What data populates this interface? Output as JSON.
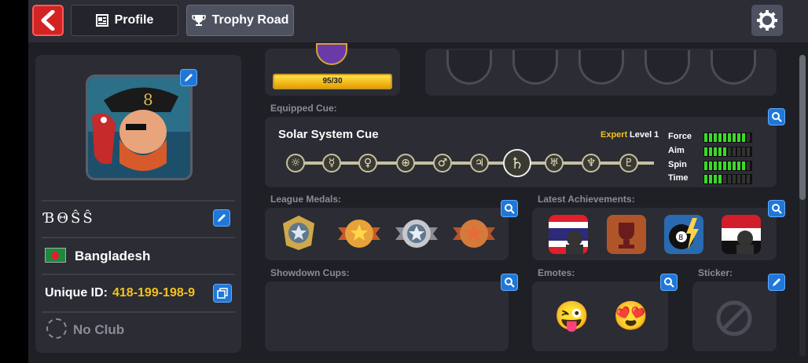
{
  "nav": {
    "profile_tab": "Profile",
    "trophy_tab": "Trophy Road"
  },
  "player": {
    "name": "ƁΘŜŜ",
    "country": "Bangladesh",
    "unique_id_label": "Unique ID:",
    "unique_id": "418-199-198-9",
    "club": "No Club",
    "level_progress": "95/30",
    "level_progress_fraction": 1.0
  },
  "cue": {
    "section_label": "Equipped Cue:",
    "name": "Solar System Cue",
    "rank": "Expert",
    "level": "Level 1",
    "stats": [
      {
        "label": "Force",
        "value": 9,
        "max": 10
      },
      {
        "label": "Aim",
        "value": 5,
        "max": 10
      },
      {
        "label": "Spin",
        "value": 9,
        "max": 10
      },
      {
        "label": "Time",
        "value": 4,
        "max": 10
      }
    ],
    "symbols": [
      "☼",
      "☿",
      "♀",
      "⊕",
      "♂",
      "♃",
      "♄",
      "♅",
      "♆",
      "♇"
    ]
  },
  "sections": {
    "league_medals": "League Medals:",
    "latest_achievements": "Latest Achievements:",
    "showdown_cups": "Showdown Cups:",
    "emotes": "Emotes:",
    "sticker": "Sticker:"
  },
  "emotes": [
    "😜",
    "😍"
  ],
  "colors": {
    "accent_blue": "#1f78d8",
    "gold": "#f4c21c",
    "back_red": "#d32424",
    "stat_green": "#3bd829"
  }
}
